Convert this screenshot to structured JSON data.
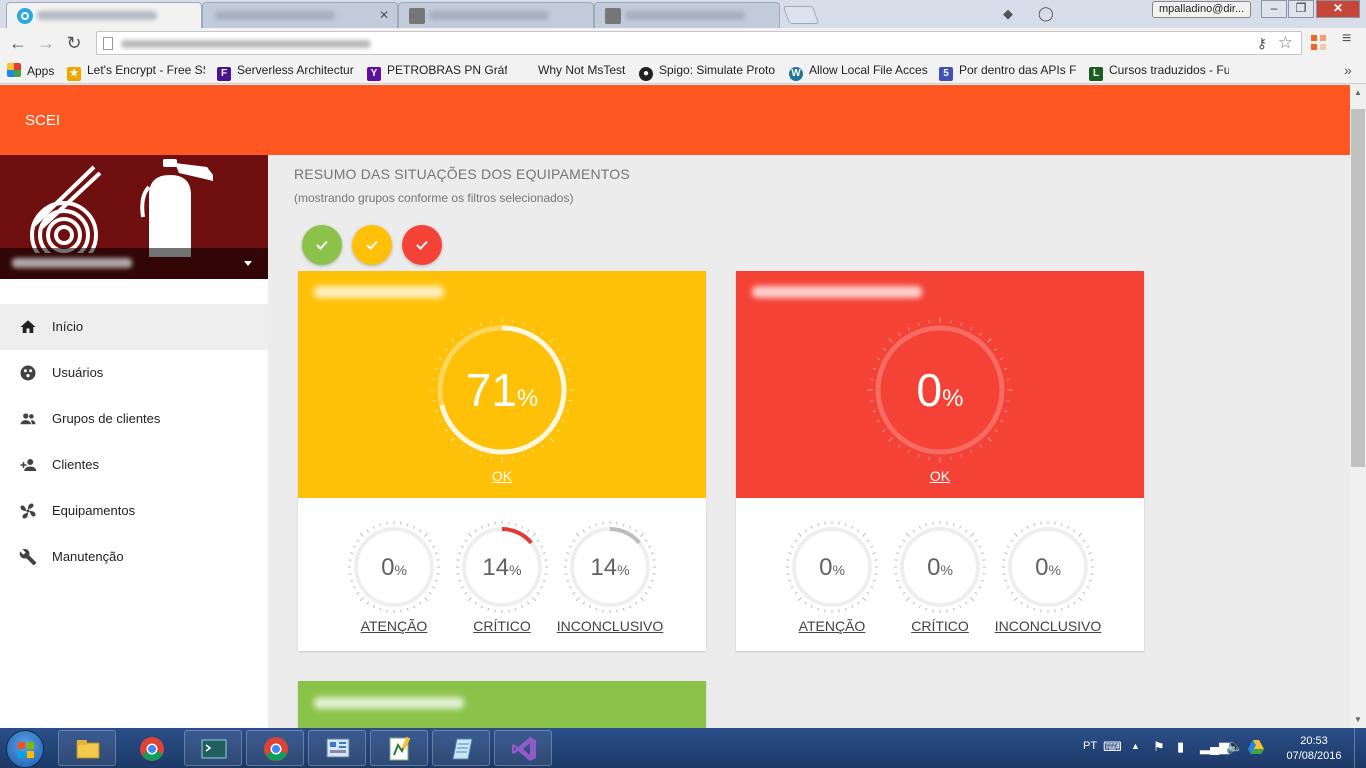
{
  "browser": {
    "user_badge": "mpalladino@dir...",
    "tabs": [
      "",
      "",
      "",
      ""
    ],
    "bookmarks": [
      {
        "label": "Apps",
        "icon": "apps-grid-icon",
        "color": "#e53935"
      },
      {
        "label": "Let's Encrypt - Free SS",
        "icon": "lets-encrypt-icon",
        "color": "#f0a500"
      },
      {
        "label": "Serverless Architectur",
        "icon": "serverless-icon",
        "color": "#4a148c"
      },
      {
        "label": "PETROBRAS PN Gráfic",
        "icon": "yahoo-icon",
        "color": "#5f0f9a"
      },
      {
        "label": "Why Not MsTest",
        "icon": "",
        "color": ""
      },
      {
        "label": "Spigo: Simulate Proto",
        "icon": "github-icon",
        "color": "#222222"
      },
      {
        "label": "Allow Local File Acces",
        "icon": "wordpress-icon",
        "color": "#21759b"
      },
      {
        "label": "Por dentro das APIs F",
        "icon": "html5-icon",
        "color": "#3f51b5"
      },
      {
        "label": "Cursos traduzidos - Fu",
        "icon": "lynda-icon",
        "color": "#1b5e20"
      }
    ]
  },
  "app": {
    "brand": "SCEI",
    "accent": "#ff5722",
    "sidebar": {
      "items": [
        {
          "label": "Início",
          "icon": "home-icon"
        },
        {
          "label": "Usuários",
          "icon": "users-icon"
        },
        {
          "label": "Grupos de clientes",
          "icon": "people-icon"
        },
        {
          "label": "Clientes",
          "icon": "person-add-icon"
        },
        {
          "label": "Equipamentos",
          "icon": "fan-icon"
        },
        {
          "label": "Manutenção",
          "icon": "wrench-icon"
        }
      ]
    },
    "main": {
      "title": "RESUMO DAS SITUAÇÕES DOS EQUIPAMENTOS",
      "subtitle": "(mostrando grupos conforme os filtros selecionados)",
      "filters": [
        {
          "color": "#8bc34a",
          "checked": true
        },
        {
          "color": "#ffc107",
          "checked": true
        },
        {
          "color": "#f44336",
          "checked": true
        }
      ],
      "cards": [
        {
          "color": "#ffc107",
          "ok": {
            "value": "71",
            "unit": "%",
            "label": "OK",
            "fraction": 0.71
          },
          "stats": [
            {
              "value": "0",
              "unit": "%",
              "label": "ATENÇÃO",
              "fraction": 0,
              "arc_color": "#ffc107"
            },
            {
              "value": "14",
              "unit": "%",
              "label": "CRÍTICO",
              "fraction": 0.14,
              "arc_color": "#e53935"
            },
            {
              "value": "14",
              "unit": "%",
              "label": "INCONCLUSIVO",
              "fraction": 0.14,
              "arc_color": "#bdbdbd"
            }
          ]
        },
        {
          "color": "#f44336",
          "ok": {
            "value": "0",
            "unit": "%",
            "label": "OK",
            "fraction": 0
          },
          "stats": [
            {
              "value": "0",
              "unit": "%",
              "label": "ATENÇÃO",
              "fraction": 0,
              "arc_color": "#ffc107"
            },
            {
              "value": "0",
              "unit": "%",
              "label": "CRÍTICO",
              "fraction": 0,
              "arc_color": "#e53935"
            },
            {
              "value": "0",
              "unit": "%",
              "label": "INCONCLUSIVO",
              "fraction": 0,
              "arc_color": "#bdbdbd"
            }
          ]
        },
        {
          "color": "#8bc34a"
        }
      ]
    }
  },
  "taskbar": {
    "lang": "PT",
    "time": "20:53",
    "date": "07/08/2016"
  }
}
